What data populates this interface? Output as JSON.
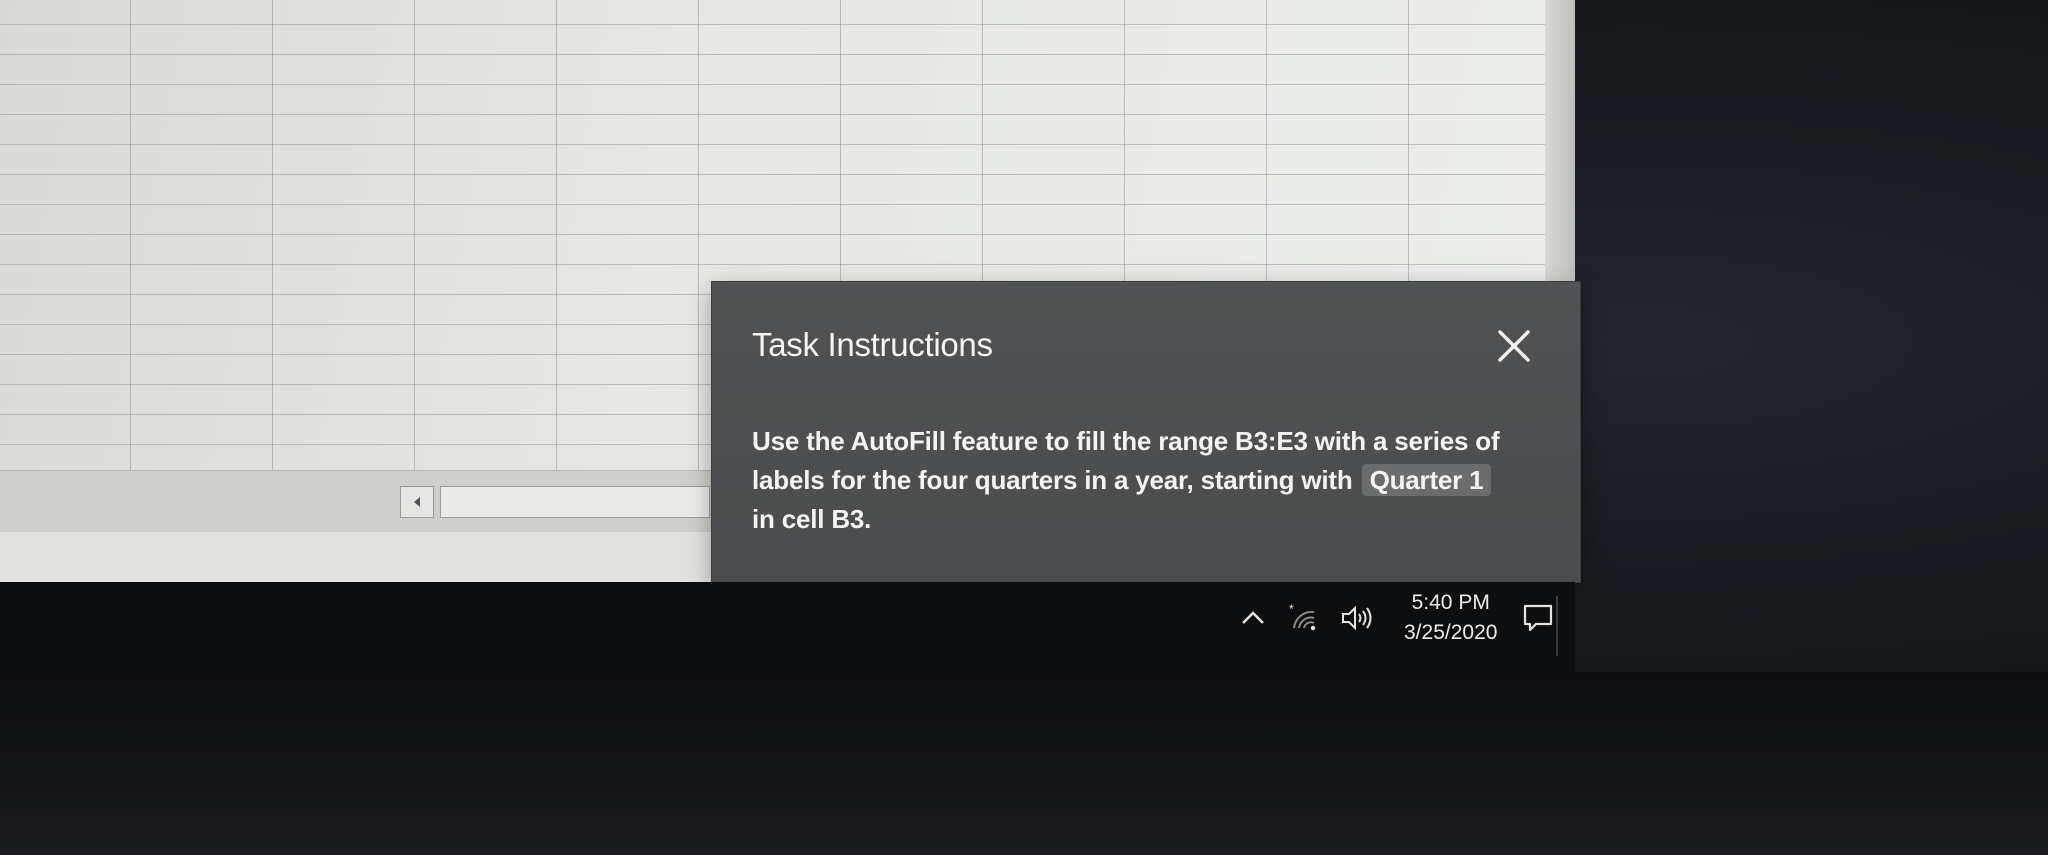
{
  "dialog": {
    "title": "Task Instructions",
    "close_icon": "close-icon",
    "body_before": "Use the AutoFill feature to fill the range B3:E3 with a series of labels for the four quarters in a year, starting with ",
    "body_highlight": "Quarter 1",
    "body_after": " in cell B3."
  },
  "taskbar": {
    "icons": [
      "chevron-up-icon",
      "wifi-icon",
      "volume-icon",
      "notification-icon"
    ],
    "time": "5:40 PM",
    "date": "3/25/2020"
  },
  "spreadsheet": {
    "scroll_left_icon": "scroll-left-arrow-icon"
  },
  "colors": {
    "dialog_bg": "#4c4e4f",
    "dialog_text": "#f3f3f3",
    "highlight_bg": "#6a6c6d",
    "taskbar_bg": "#0d0e10",
    "grid_line": "#969896"
  }
}
